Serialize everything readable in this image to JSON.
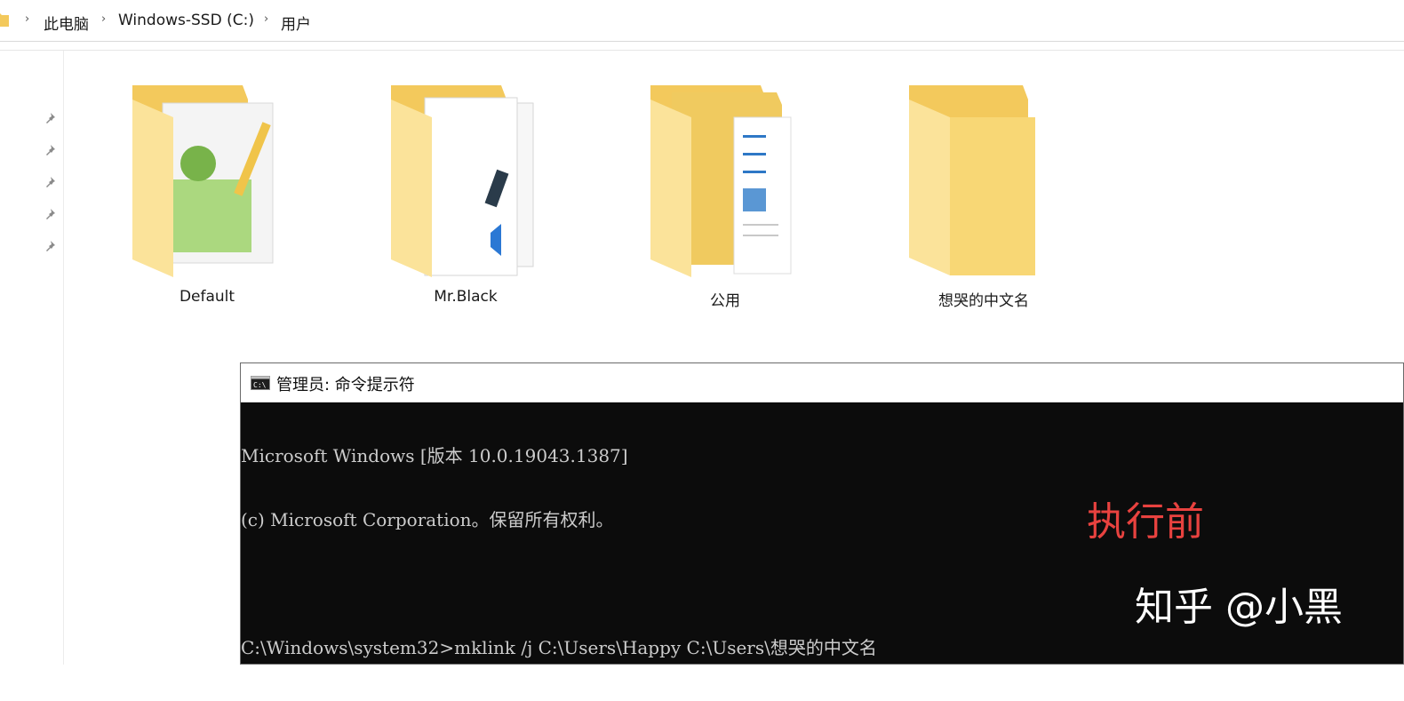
{
  "address_bar": {
    "crumbs": [
      "此电脑",
      "Windows-SSD (C:)",
      "用户"
    ],
    "separator_icon": "chevron-right-icon"
  },
  "nav": {
    "pin_icon": "pin-icon",
    "pin_count": 5
  },
  "folders": [
    {
      "name": "Default",
      "icon": "folder-with-notepad-icon"
    },
    {
      "name": "Mr.Black",
      "icon": "folder-with-documents-icon"
    },
    {
      "name": "公用",
      "icon": "folder-with-pages-icon"
    },
    {
      "name": "想哭的中文名",
      "icon": "empty-folder-icon"
    }
  ],
  "cmd": {
    "title": "管理员: 命令提示符",
    "lines": [
      "Microsoft Windows [版本 10.0.19043.1387]",
      "(c) Microsoft Corporation。保留所有权利。",
      "",
      "C:\\Windows\\system32>mklink /j C:\\Users\\Happy C:\\Users\\想哭的中文名"
    ],
    "overlay": "执行前",
    "watermark": "知乎 @小黑"
  },
  "colors": {
    "folder": "#f8d775",
    "folder_dark": "#e9bd4e",
    "overlay_red": "#e8423f",
    "console_bg": "#0c0c0c"
  }
}
